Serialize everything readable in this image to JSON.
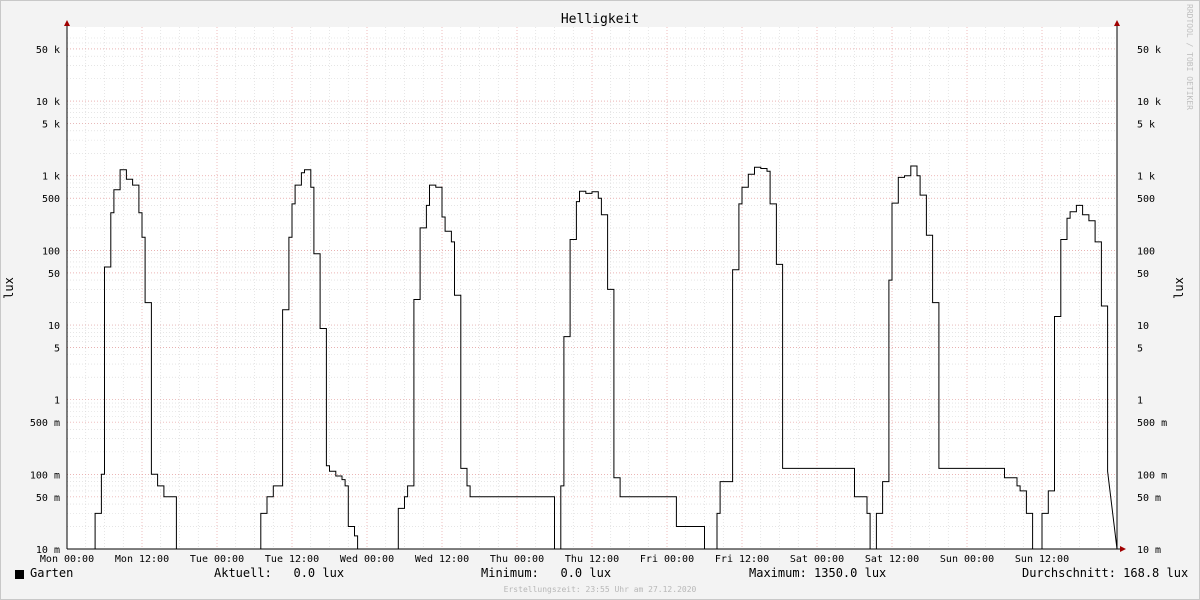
{
  "chart_data": {
    "type": "line",
    "title": "Helligkeit",
    "ylabel": "lux",
    "yscale": "log",
    "ylim": [
      0.01,
      70000
    ],
    "y_ticks": [
      {
        "value": 50000,
        "label": "50 k"
      },
      {
        "value": 10000,
        "label": "10 k"
      },
      {
        "value": 5000,
        "label": "5 k"
      },
      {
        "value": 1000,
        "label": "1 k"
      },
      {
        "value": 500,
        "label": "500"
      },
      {
        "value": 100,
        "label": "100"
      },
      {
        "value": 50,
        "label": "50"
      },
      {
        "value": 10,
        "label": "10"
      },
      {
        "value": 5,
        "label": "5"
      },
      {
        "value": 1,
        "label": "1"
      },
      {
        "value": 0.5,
        "label": "500 m"
      },
      {
        "value": 0.1,
        "label": "100 m"
      },
      {
        "value": 0.05,
        "label": "50 m"
      },
      {
        "value": 0.01,
        "label": "10 m"
      }
    ],
    "x_ticks": [
      "Mon 00:00",
      "Mon 12:00",
      "Tue 00:00",
      "Tue 12:00",
      "Wed 00:00",
      "Wed 12:00",
      "Thu 00:00",
      "Thu 12:00",
      "Fri 00:00",
      "Fri 12:00",
      "Sat 00:00",
      "Sat 12:00",
      "Sun 00:00",
      "Sun 12:00"
    ],
    "grid": true,
    "series": [
      {
        "name": "Garten",
        "color": "#000000",
        "x_hours": [
          3.5,
          4.5,
          5.5,
          6,
          7,
          7.5,
          8.5,
          9.5,
          10.5,
          11.5,
          12,
          12.5,
          13.5,
          14.5,
          15.5,
          16.5,
          17.5,
          18,
          19,
          20,
          21,
          21.5,
          22.5,
          23.5,
          30.5,
          31,
          32,
          33,
          33.5,
          34.5,
          35.5,
          36,
          36.5,
          37.5,
          38,
          39,
          39.5,
          40.5,
          41.5,
          42,
          43,
          44,
          44.5,
          45,
          46,
          46.5,
          52,
          53,
          54,
          54.5,
          55.5,
          56.5,
          57.5,
          58,
          59,
          60,
          60.5,
          61.5,
          62,
          63,
          64,
          64.5,
          65.5,
          66.5,
          78,
          79,
          79.5,
          80.5,
          81.5,
          82,
          83,
          84,
          85,
          85.5,
          86.5,
          87.5,
          88.5,
          96.5,
          97.5,
          102,
          103,
          104,
          104.5,
          105.5,
          106.5,
          107.5,
          108,
          109,
          110,
          111,
          112,
          112.5,
          113.5,
          114.5,
          126,
          127,
          128,
          128.5,
          129.5,
          130.5,
          131.5,
          132,
          133,
          134,
          135,
          136,
          136.5,
          137.5,
          138.5,
          139.5,
          150,
          151,
          152,
          152.5,
          153.5,
          154.5,
          155.5,
          156,
          157,
          158,
          159,
          160,
          160.5,
          161.5,
          162.5,
          163.5,
          164.5,
          165.5,
          166.5
        ],
        "values": [
          0.01,
          0.03,
          0.1,
          60,
          320,
          650,
          1200,
          900,
          750,
          320,
          150,
          20,
          0.1,
          0.07,
          0.05,
          0.05,
          0.01,
          0.01,
          0.01,
          0.01,
          0.01,
          0.01,
          0.01,
          0.01,
          0.01,
          0.03,
          0.05,
          0.07,
          0.07,
          16,
          150,
          420,
          750,
          1100,
          1200,
          700,
          90,
          9,
          0.13,
          0.11,
          0.095,
          0.085,
          0.07,
          0.02,
          0.015,
          0.01,
          0.01,
          0.035,
          0.05,
          0.07,
          22,
          200,
          400,
          750,
          700,
          280,
          180,
          130,
          25,
          0.12,
          0.07,
          0.05,
          0.05,
          0.05,
          0.01,
          0.07,
          7,
          140,
          450,
          620,
          580,
          610,
          500,
          300,
          30,
          0.09,
          0.05,
          0.05,
          0.02,
          0.01,
          0.01,
          0.03,
          0.08,
          0.08,
          55,
          420,
          700,
          1050,
          1300,
          1250,
          1150,
          420,
          65,
          0.12,
          0.05,
          0.05,
          0.03,
          0.01,
          0.03,
          0.08,
          40,
          430,
          950,
          1000,
          1350,
          1000,
          550,
          160,
          20,
          0.12,
          0.09,
          0.09,
          0.07,
          0.06,
          0.03,
          0.01,
          0.01,
          0.03,
          0.06,
          13,
          140,
          270,
          330,
          400,
          300,
          250,
          130,
          18,
          0.11,
          0.08,
          0.07,
          0.06,
          0.05,
          0.05,
          0.01
        ]
      }
    ]
  },
  "legend": {
    "series_name": "Garten",
    "current": "Aktuell:   0.0 lux",
    "minimum": "Minimum:   0.0 lux",
    "maximum": "Maximum: 1350.0 lux",
    "average": "Durchschnitt: 168.8 lux"
  },
  "footer": "Erstellungszeit: 23:55 Uhr am 27.12.2020",
  "watermark": "RRDTOOL / TOBI OETIKER"
}
